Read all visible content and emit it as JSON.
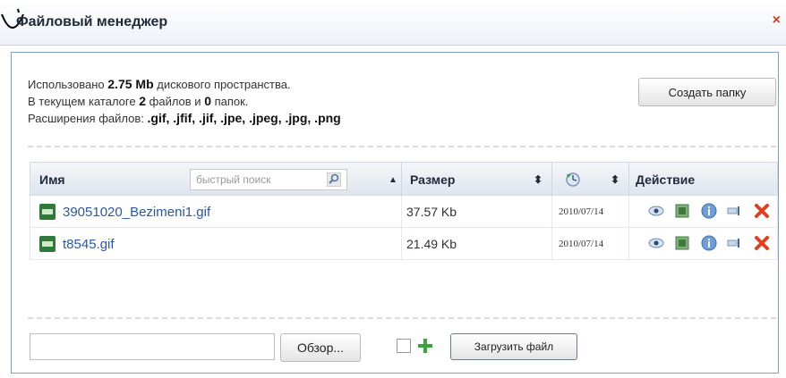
{
  "window": {
    "title": "Файловый менеджер",
    "close_glyph": "×"
  },
  "info": {
    "line1_prefix": "Использовано",
    "used_space": "2.75 Mb",
    "line1_suffix": "дискового пространства.",
    "line2_prefix": "В текущем каталоге",
    "files_count": "2",
    "line2_mid": "файлов и",
    "folders_count": "0",
    "line2_suffix": "папок.",
    "line3_prefix": "Расширения файлов:",
    "extensions": ".gif, .jfif, .jif, .jpe, .jpeg, .jpg, .png"
  },
  "toolbar": {
    "create_folder_label": "Создать папку"
  },
  "table": {
    "col_name": "Имя",
    "search_placeholder": "быстрый поиск",
    "col_size": "Размер",
    "col_action": "Действие",
    "sort_up_glyph": "▲",
    "sort_both_glyph": "⬍",
    "rows": [
      {
        "name": "39051020_Bezimeni1.gif",
        "size": "37.57 Kb",
        "date": "2010/07/14"
      },
      {
        "name": "t8545.gif",
        "size": "21.49 Kb",
        "date": "2010/07/14"
      }
    ]
  },
  "upload": {
    "browse_label": "Обзор...",
    "upload_label": "Загрузить файл"
  },
  "colors": {
    "link": "#2a56a8",
    "border": "#7fa0c8",
    "delete": "#e0401f",
    "plus": "#3aa63a"
  },
  "icons": {
    "file": "gif-file-icon",
    "view": "eye-icon",
    "edit": "edit-icon",
    "info": "info-icon",
    "rename": "rename-icon",
    "delete": "delete-icon",
    "search": "magnifier-icon",
    "clock": "clock-icon",
    "add": "plus-icon"
  }
}
